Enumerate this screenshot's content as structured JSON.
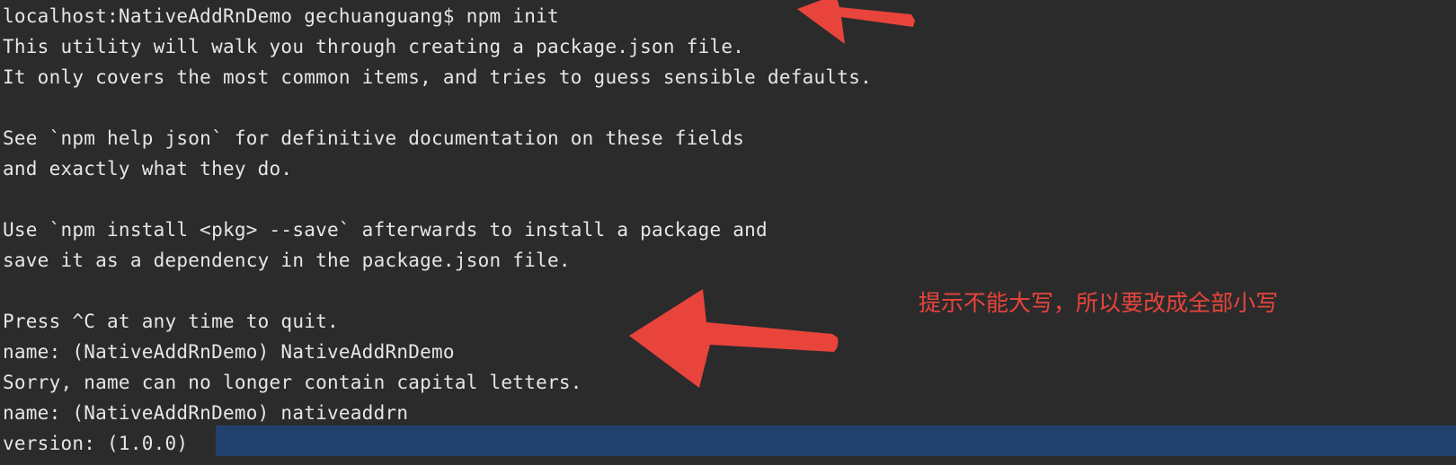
{
  "terminal": {
    "lines": {
      "l0": "localhost:NativeAddRnDemo gechuanguang$ npm init",
      "l1": "This utility will walk you through creating a package.json file.",
      "l2": "It only covers the most common items, and tries to guess sensible defaults.",
      "l4": "See `npm help json` for definitive documentation on these fields",
      "l5": "and exactly what they do.",
      "l7": "Use `npm install <pkg> --save` afterwards to install a package and",
      "l8": "save it as a dependency in the package.json file.",
      "l10": "Press ^C at any time to quit.",
      "l11": "name: (NativeAddRnDemo) NativeAddRnDemo",
      "l12": "Sorry, name can no longer contain capital letters.",
      "l13": "name: (NativeAddRnDemo) nativeaddrn",
      "l14": "version: (1.0.0) "
    },
    "background": "#2b2b2b",
    "text_color": "#e6e6e6",
    "selection_color": "#23416e"
  },
  "annotations": {
    "note_text": "提示不能大写，所以要改成全部小写",
    "arrow_color": "#e9443c",
    "arrows": [
      "arrow-to-npm-init",
      "arrow-to-name-error"
    ]
  }
}
